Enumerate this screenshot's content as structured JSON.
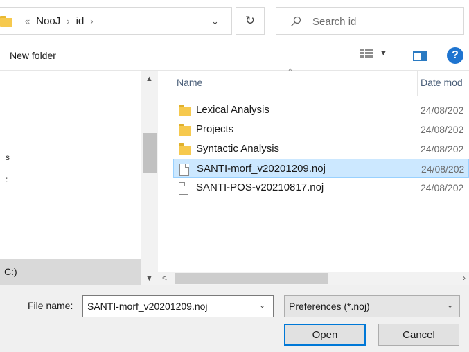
{
  "address": {
    "crumbs": [
      "«",
      "NooJ",
      "›",
      "id",
      "›"
    ],
    "dropdown_glyph": "⌄",
    "refresh_glyph": "↻"
  },
  "search": {
    "placeholder": "Search id"
  },
  "toolbar": {
    "new_folder": "New folder",
    "help_glyph": "?"
  },
  "nav": {
    "frag1": "s",
    "frag2": ":",
    "selected_drive": "C:)"
  },
  "columns": {
    "name": "Name",
    "date": "Date mod"
  },
  "files": [
    {
      "name": "Lexical Analysis",
      "date": "24/08/202",
      "type": "folder"
    },
    {
      "name": "Projects",
      "date": "24/08/202",
      "type": "folder"
    },
    {
      "name": "Syntactic Analysis",
      "date": "24/08/202",
      "type": "folder"
    },
    {
      "name": "SANTI-morf_v20201209.noj",
      "date": "24/08/202",
      "type": "file",
      "selected": true
    },
    {
      "name": "SANTI-POS-v20210817.noj",
      "date": "24/08/202",
      "type": "file"
    }
  ],
  "bottom": {
    "file_name_label": "File name:",
    "file_name_value": "SANTI-morf_v20201209.noj",
    "file_type_value": "Preferences (*.noj)",
    "open_label": "Open",
    "cancel_label": "Cancel"
  },
  "colors": {
    "selection": "#cce8ff",
    "accent": "#0078d7",
    "folder": "#f6c94e"
  },
  "icons": [
    "folder-icon",
    "search-icon",
    "refresh-icon",
    "view-options-icon",
    "preview-pane-icon",
    "help-icon",
    "file-icon"
  ]
}
